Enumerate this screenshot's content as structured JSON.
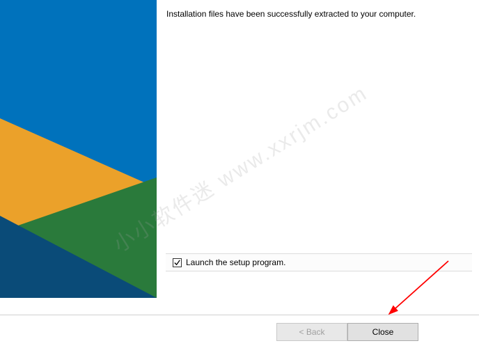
{
  "main": {
    "message": "Installation files have been successfully extracted to your computer."
  },
  "checkbox": {
    "label": "Launch the setup program.",
    "checked": true
  },
  "buttons": {
    "back": "< Back",
    "close": "Close"
  },
  "watermark": {
    "text": "小小软件迷  www.xxrjm.com"
  },
  "colors": {
    "sidebar_blue": "#0072bc",
    "sidebar_orange": "#f5a623",
    "sidebar_green": "#2e7d32",
    "sidebar_navy": "#0a4b78"
  }
}
